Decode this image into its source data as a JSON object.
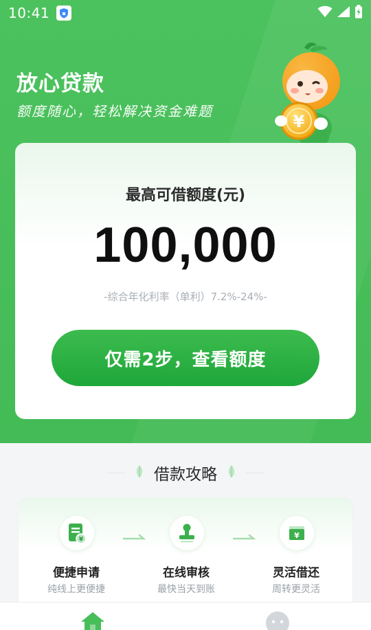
{
  "status_bar": {
    "time": "10:41",
    "icons": [
      "shield-icon",
      "wifi-icon",
      "signal-icon",
      "battery-icon"
    ]
  },
  "hero": {
    "title": "放心贷款",
    "subtitle": "额度随心，轻松解决资金难题"
  },
  "card": {
    "label": "最高可借额度(元)",
    "amount": "100,000",
    "rate": "-综合年化利率（单利）7.2%-24%-",
    "button_label": "仅需2步，查看额度"
  },
  "guide": {
    "title": "借款攻略",
    "steps": [
      {
        "icon": "application-icon",
        "title": "便捷申请",
        "desc": "纯线上更便捷"
      },
      {
        "icon": "review-stamp-icon",
        "title": "在线审核",
        "desc": "最快当天到账"
      },
      {
        "icon": "wallet-icon",
        "title": "灵活借还",
        "desc": "周转更灵活"
      }
    ]
  },
  "tabbar": {
    "items": [
      {
        "icon": "home-icon"
      },
      {
        "icon": "profile-icon"
      }
    ]
  },
  "colors": {
    "brand_green": "#47be59",
    "button_green": "#1fa73a"
  }
}
